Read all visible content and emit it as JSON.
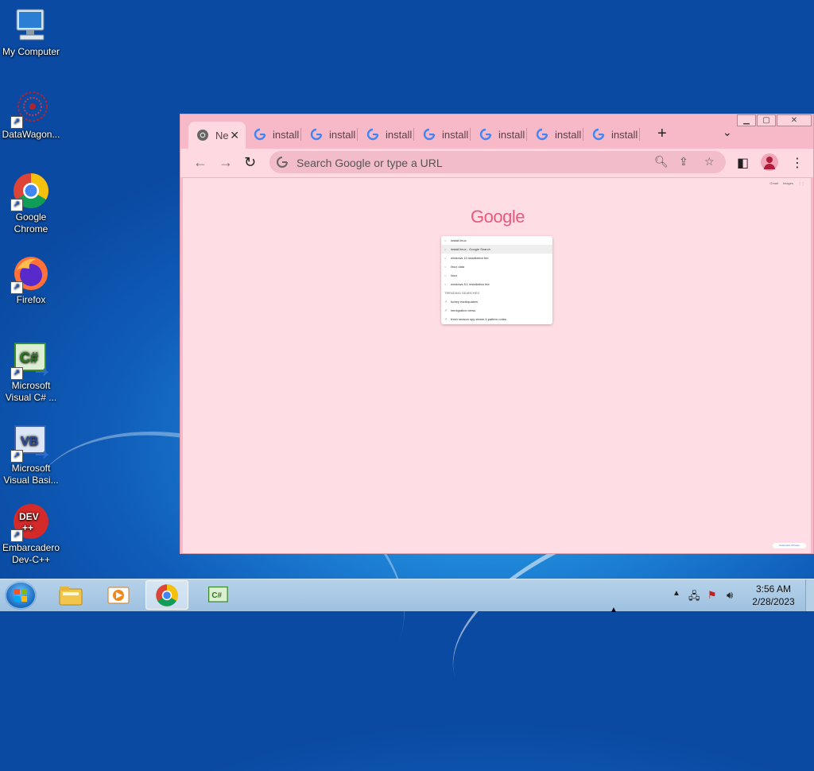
{
  "desktop": {
    "icons": [
      {
        "label": "My Computer",
        "icon": "computer-icon"
      },
      {
        "label": "DataWagon...",
        "icon": "datawagon-icon"
      },
      {
        "label": "Google Chrome",
        "icon": "chrome-icon"
      },
      {
        "label": "Firefox",
        "icon": "firefox-icon"
      },
      {
        "label": "Microsoft Visual C# ...",
        "icon": "visual-csharp-icon"
      },
      {
        "label": "Microsoft Visual Basi...",
        "icon": "visual-basic-icon"
      },
      {
        "label": "Embarcadero Dev-C++",
        "icon": "devcpp-icon"
      }
    ]
  },
  "browser": {
    "tabs": [
      {
        "title": "Ne",
        "active": true
      },
      {
        "title": "install"
      },
      {
        "title": "install"
      },
      {
        "title": "install"
      },
      {
        "title": "install"
      },
      {
        "title": "install"
      },
      {
        "title": "install"
      },
      {
        "title": "install"
      }
    ],
    "new_tab_symbol": "+",
    "omnibox_placeholder": "Search Google or type a URL",
    "page": {
      "top_links": [
        "Gmail",
        "Images"
      ],
      "logo": "Google",
      "search_text": "install linux",
      "suggestions": [
        "install linux - Google Search",
        "windows 10 installation fee",
        "linux data",
        "linux",
        "windows 8.1 installation fee"
      ],
      "trending_header": "TRENDING SEARCHES",
      "trending": [
        "turkey earthquakes",
        "immigration news",
        "fresh season spy steam 6 pattern notes"
      ],
      "customize_label": "Customize Chrome"
    }
  },
  "taskbar": {
    "pinned": [
      "start-button",
      "explorer-icon",
      "media-player-icon",
      "chrome-icon",
      "visual-csharp-icon"
    ],
    "clock_time": "3:56 AM",
    "clock_date": "2/28/2023"
  },
  "colors": {
    "window_frame": "#f7b9c8",
    "page_bg": "#ffdde4",
    "logo": "#e85a7e",
    "taskbar": "#b6d2ea"
  }
}
